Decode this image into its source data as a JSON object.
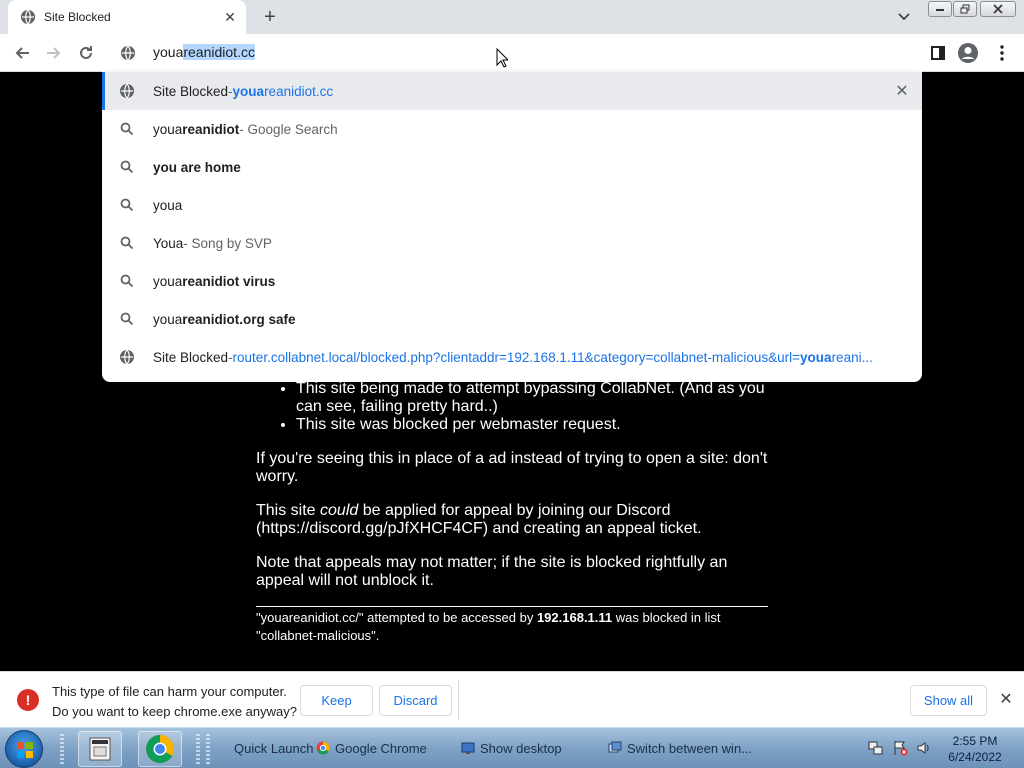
{
  "tab": {
    "title": "Site Blocked",
    "close": "✕"
  },
  "toolbar": {
    "omnibox_typed": "youa",
    "omnibox_completion": "reanidiot.cc"
  },
  "suggestions": [
    {
      "type": "history",
      "title": "Site Blocked",
      "sep": " - ",
      "url_bold": "youa",
      "url_rest": "reanidiot.cc",
      "remove": "✕"
    },
    {
      "type": "search",
      "pre": "youa",
      "bold": "reanidiot",
      "suffix": " - Google Search"
    },
    {
      "type": "search",
      "bold_full": "you are home"
    },
    {
      "type": "search",
      "plain": "youa"
    },
    {
      "type": "search",
      "pre": "Youa",
      "suffix": " - Song by SVP"
    },
    {
      "type": "search",
      "pre": "youa",
      "bold": "reanidiot virus"
    },
    {
      "type": "search",
      "pre": "youa",
      "bold": "reanidiot.org safe"
    },
    {
      "type": "history",
      "title": "Site Blocked",
      "sep": " - ",
      "url_pre": "router.collabnet.local/blocked.php?clientaddr=192.168.1.11&category=collabnet-malicious&url=",
      "url_bold": "youa",
      "url_rest": "reani..."
    }
  ],
  "page": {
    "bullets": [
      "This site being made to attempt bypassing CollabNet. (And as you can see, failing pretty hard..)",
      "This site was blocked per webmaster request."
    ],
    "para1": "If you're seeing this in place of a ad instead of trying to open a site: don't worry.",
    "para2_pre": "This site ",
    "para2_em": "could",
    "para2_post": " be applied for appeal by joining our Discord (https://discord.gg/pJfXHCF4CF) and creating an appeal ticket.",
    "para3": "Note that appeals may not matter; if the site is blocked rightfully an appeal will not unblock it.",
    "foot_pre": "\"youareanidiot.cc/\" attempted to be accessed by ",
    "foot_ip": "192.168.1.11",
    "foot_post": " was blocked in list \"collabnet-malicious\"."
  },
  "download": {
    "line1": "This type of file can harm your computer.",
    "line2": "Do you want to keep chrome.exe anyway?",
    "keep": "Keep",
    "discard": "Discard",
    "show_all": "Show all"
  },
  "taskbar": {
    "quick_launch": "Quick Launch",
    "items": [
      "Google Chrome",
      "Show desktop",
      "Switch between win..."
    ],
    "time": "2:55 PM",
    "date": "6/24/2022"
  },
  "colors": {
    "accent": "#1a73e8",
    "warning": "#d93025"
  }
}
